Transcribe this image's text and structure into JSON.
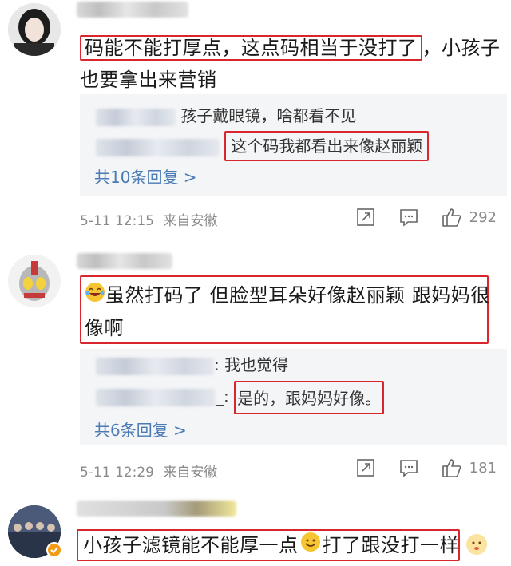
{
  "comments": [
    {
      "text_boxed": "码能不能打厚点，这点码相当于没打了",
      "text_rest": "，小孩子也要拿出来营销",
      "replies": [
        {
          "text": "孩子戴眼镜，啥都看不见"
        },
        {
          "text": "这个码我都看出来像赵丽颖"
        }
      ],
      "reply_count": "共10条回复 >",
      "time": "5-11 12:15",
      "source": "来自安徽",
      "likes": "292"
    },
    {
      "text_l1": "虽然打码了 但脸型耳朵好像赵丽颖 跟妈妈很",
      "text_l2": "像啊",
      "replies": [
        {
          "text": ": 我也觉得"
        },
        {
          "prefix": "_:",
          "text": "是的，跟妈妈好像。"
        }
      ],
      "reply_count": "共6条回复 >",
      "time": "5-11 12:29",
      "source": "来自安徽",
      "likes": "181"
    },
    {
      "text_a": "小孩子滤镜能不能厚一点",
      "text_b": "打了跟没打一样"
    }
  ],
  "icons": {
    "share": "share-icon",
    "comment": "comment-icon",
    "like": "thumbs-up-icon",
    "laugh": "laughing-emoji",
    "smile": "smile-emoji",
    "verified": "verified-badge-icon"
  },
  "colors": {
    "highlight": "#d9262c",
    "link": "#4a7bb5",
    "meta": "#8a8a8a",
    "reply_bg": "#f4f5f7"
  }
}
